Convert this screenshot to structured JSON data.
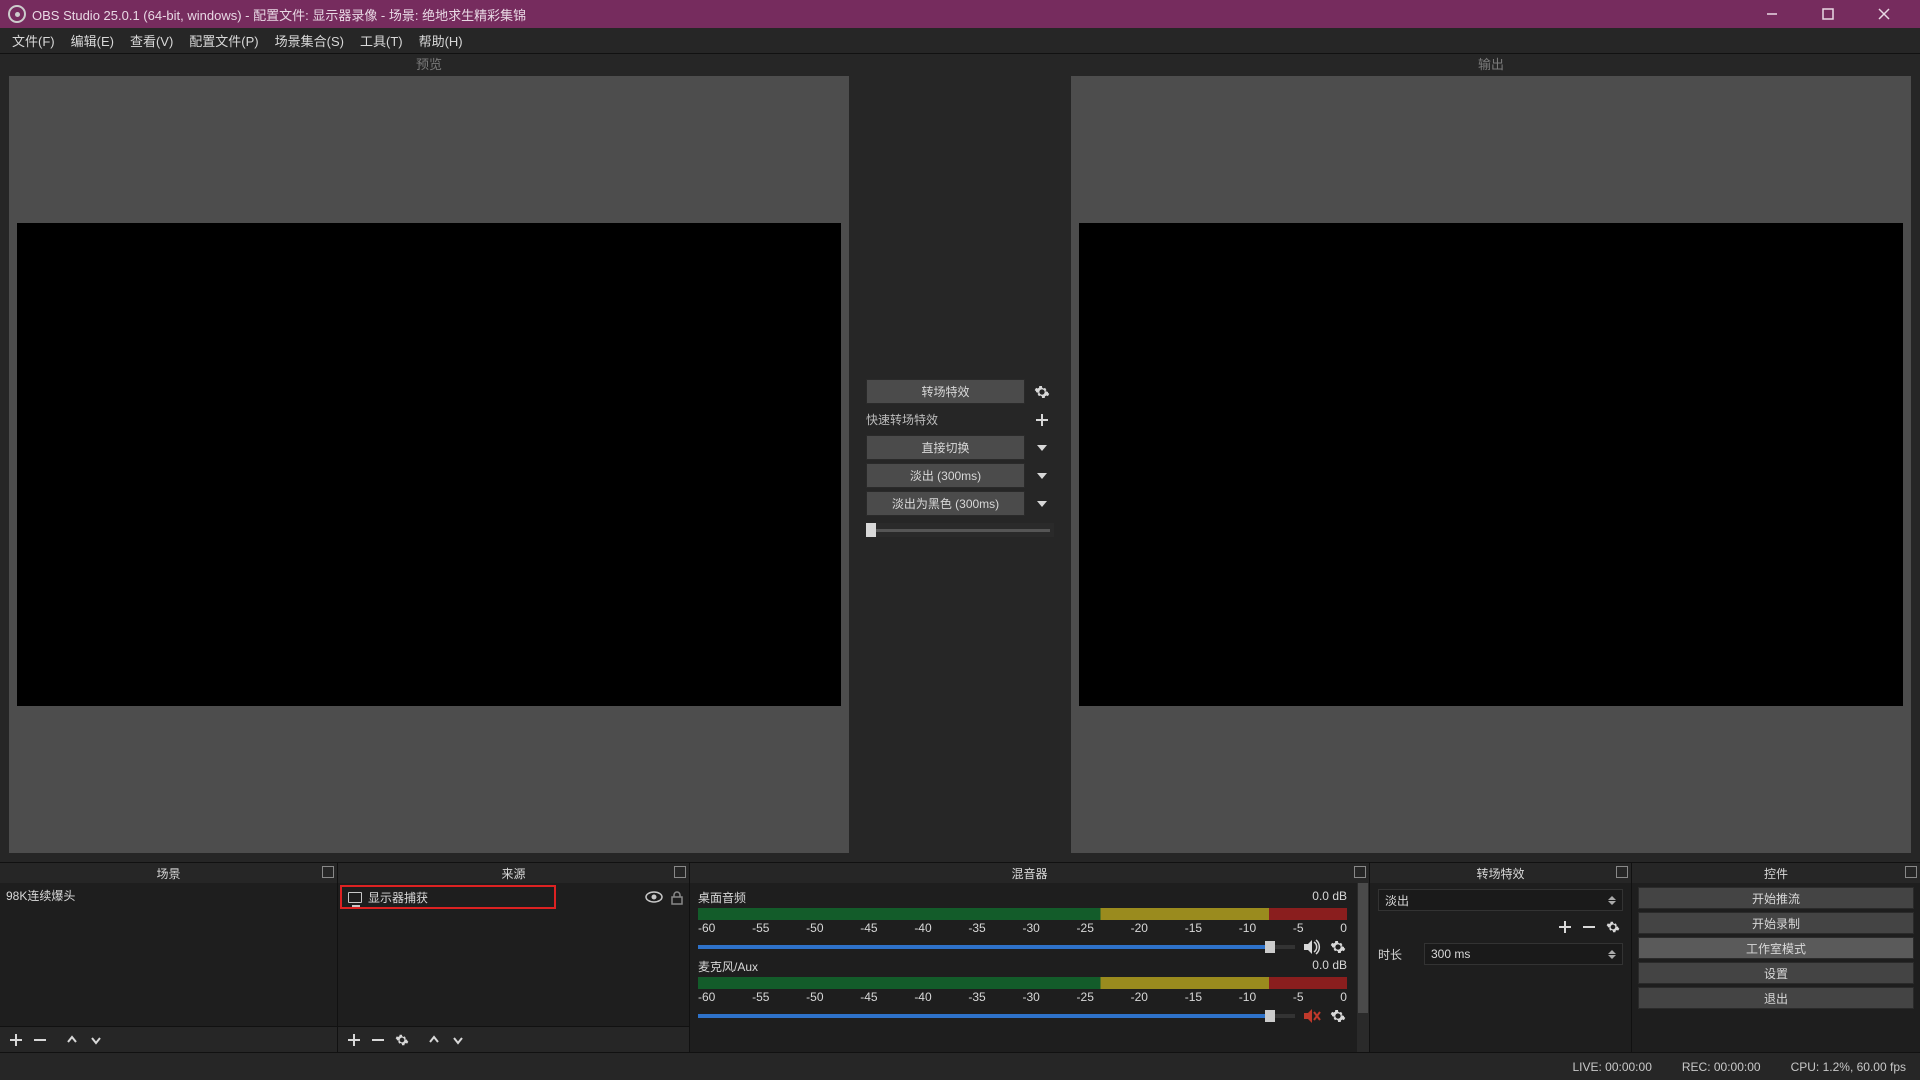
{
  "titlebar": {
    "title": "OBS Studio 25.0.1 (64-bit, windows) - 配置文件: 显示器录像 - 场景: 绝地求生精彩集锦"
  },
  "menubar": {
    "items": [
      "文件(F)",
      "编辑(E)",
      "查看(V)",
      "配置文件(P)",
      "场景集合(S)",
      "工具(T)",
      "帮助(H)"
    ]
  },
  "panes": {
    "preview": "预览",
    "output": "输出"
  },
  "transition": {
    "main_btn": "转场特效",
    "quick_label": "快速转场特效",
    "options": [
      "直接切换",
      "淡出 (300ms)",
      "淡出为黑色 (300ms)"
    ]
  },
  "docks": {
    "scenes_title": "场景",
    "sources_title": "来源",
    "mixer_title": "混音器",
    "scenetrans_title": "转场特效",
    "controls_title": "控件"
  },
  "scenes": {
    "items": [
      "98K连续爆头"
    ]
  },
  "sources": {
    "items": [
      "显示器捕获"
    ]
  },
  "mixer": {
    "ticks": [
      "-60",
      "-55",
      "-50",
      "-45",
      "-40",
      "-35",
      "-30",
      "-25",
      "-20",
      "-15",
      "-10",
      "-5",
      "0"
    ],
    "channels": [
      {
        "name": "桌面音频",
        "db": "0.0 dB",
        "muted": false
      },
      {
        "name": "麦克风/Aux",
        "db": "0.0 dB",
        "muted": true
      }
    ]
  },
  "scene_transition": {
    "selected": "淡出",
    "duration_label": "时长",
    "duration_value": "300 ms"
  },
  "controls": {
    "buttons": [
      "开始推流",
      "开始录制",
      "工作室模式",
      "设置",
      "退出"
    ],
    "active_index": 2
  },
  "status": {
    "live": "LIVE: 00:00:00",
    "rec": "REC: 00:00:00",
    "cpu": "CPU: 1.2%, 60.00 fps"
  },
  "colors": {
    "accent": "#762c5e",
    "highlight": "#d22"
  }
}
